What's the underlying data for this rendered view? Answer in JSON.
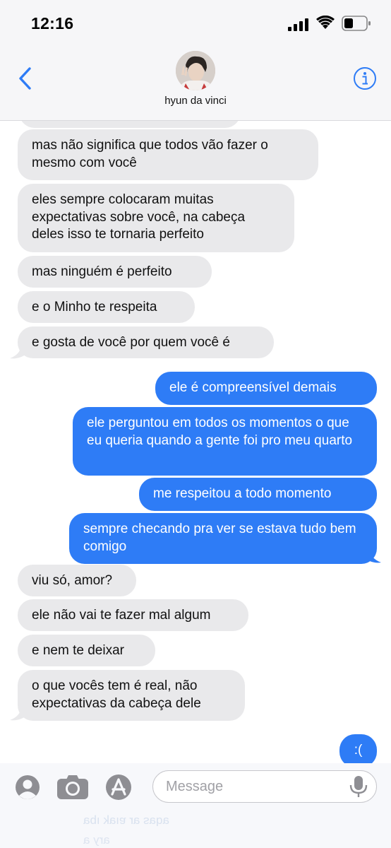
{
  "status_bar": {
    "time": "12:16"
  },
  "header": {
    "contact_name": "hyun da vinci"
  },
  "messages": [
    {
      "text": "mas não significa que todos vão fazer o mesmo com você",
      "direction": "in"
    },
    {
      "text": "eles sempre colocaram muitas expectativas sobre você, na cabeça deles isso te tornaria perfeito",
      "direction": "in"
    },
    {
      "text": "mas ninguém é perfeito",
      "direction": "in"
    },
    {
      "text": "e o Minho te respeita",
      "direction": "in"
    },
    {
      "text": "e gosta de você por quem você é",
      "direction": "in"
    },
    {
      "text": "ele é compreensível demais",
      "direction": "out"
    },
    {
      "text": "ele perguntou em todos os momentos o que eu queria quando a gente foi pro meu quarto",
      "direction": "out"
    },
    {
      "text": "me respeitou a todo momento",
      "direction": "out"
    },
    {
      "text": "sempre checando pra ver se estava tudo bem comigo",
      "direction": "out"
    },
    {
      "text": "viu só, amor?",
      "direction": "in"
    },
    {
      "text": "ele não vai te fazer mal algum",
      "direction": "in"
    },
    {
      "text": "e nem te deixar",
      "direction": "in"
    },
    {
      "text": "o que vocês tem é real, não expectativas da cabeça dele",
      "direction": "in"
    },
    {
      "text": ":(",
      "direction": "out"
    }
  ],
  "input": {
    "placeholder": "Message"
  },
  "colors": {
    "accent": "#2e7cf6",
    "incoming": "#e9e9eb",
    "header_bg": "#f6f6f8"
  },
  "icons": [
    "back-chevron-icon",
    "info-icon",
    "contact-avatar",
    "memoji-icon",
    "camera-icon",
    "app-store-icon",
    "microphone-icon"
  ]
}
